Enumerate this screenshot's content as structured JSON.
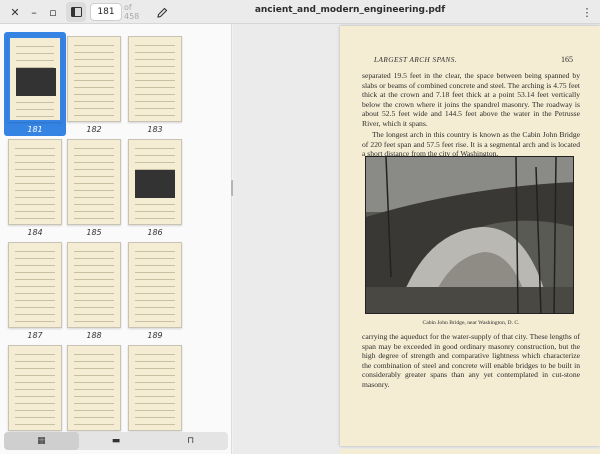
{
  "window": {
    "title": "ancient_and_modern_engineering.pdf"
  },
  "toolbar": {
    "close_icon": "✕",
    "minimize_icon": "–",
    "maximize_icon": "▫",
    "sidebar_toggle_icon": "sidebar-icon",
    "page_current": "181",
    "page_of": "of 458",
    "edit_icon": "pencil-icon",
    "menu_icon": "⋮"
  },
  "thumbnails": [
    {
      "label": "181",
      "selected": true
    },
    {
      "label": "182",
      "selected": false
    },
    {
      "label": "183",
      "selected": false
    },
    {
      "label": "184",
      "selected": false
    },
    {
      "label": "185",
      "selected": false
    },
    {
      "label": "186",
      "selected": false
    },
    {
      "label": "187",
      "selected": false
    },
    {
      "label": "188",
      "selected": false
    },
    {
      "label": "189",
      "selected": false
    },
    {
      "label": "",
      "selected": false
    },
    {
      "label": "",
      "selected": false
    },
    {
      "label": "",
      "selected": false
    }
  ],
  "sidebar_tabs": {
    "thumbnails": "▦",
    "annotations": "▬",
    "bookmarks": "⊓"
  },
  "page": {
    "running_head": "LARGEST ARCH SPANS.",
    "number": "165",
    "para1": "separated 19.5 feet in the clear, the space between being spanned by slabs or beams of combined concrete and steel. The arching is 4.75 feet thick at the crown and 7.18 feet thick at a point 53.14 feet vertically below the crown where it joins the spandrel masonry. The roadway is about 52.5 feet wide and 144.5 feet above the water in the Petrusse River, which it spans.",
    "para2": "The longest arch in this country is known as the Cabin John Bridge of 220 feet span and 57.5 feet rise. It is a segmental arch and is located a short distance from the city of Washington,",
    "caption": "Cabin John Bridge, near Washington, D. C.",
    "para3": "carrying the aqueduct for the water-supply of that city. These lengths of span may be exceeded in good ordinary masonry construction, but the high degree of strength and comparative lightness which characterize the combination of steel and concrete will enable bridges to be built in considerably greater spans than any yet contemplated in cut-stone masonry."
  },
  "colors": {
    "accent": "#3584e4",
    "paper": "#f5edd3"
  }
}
